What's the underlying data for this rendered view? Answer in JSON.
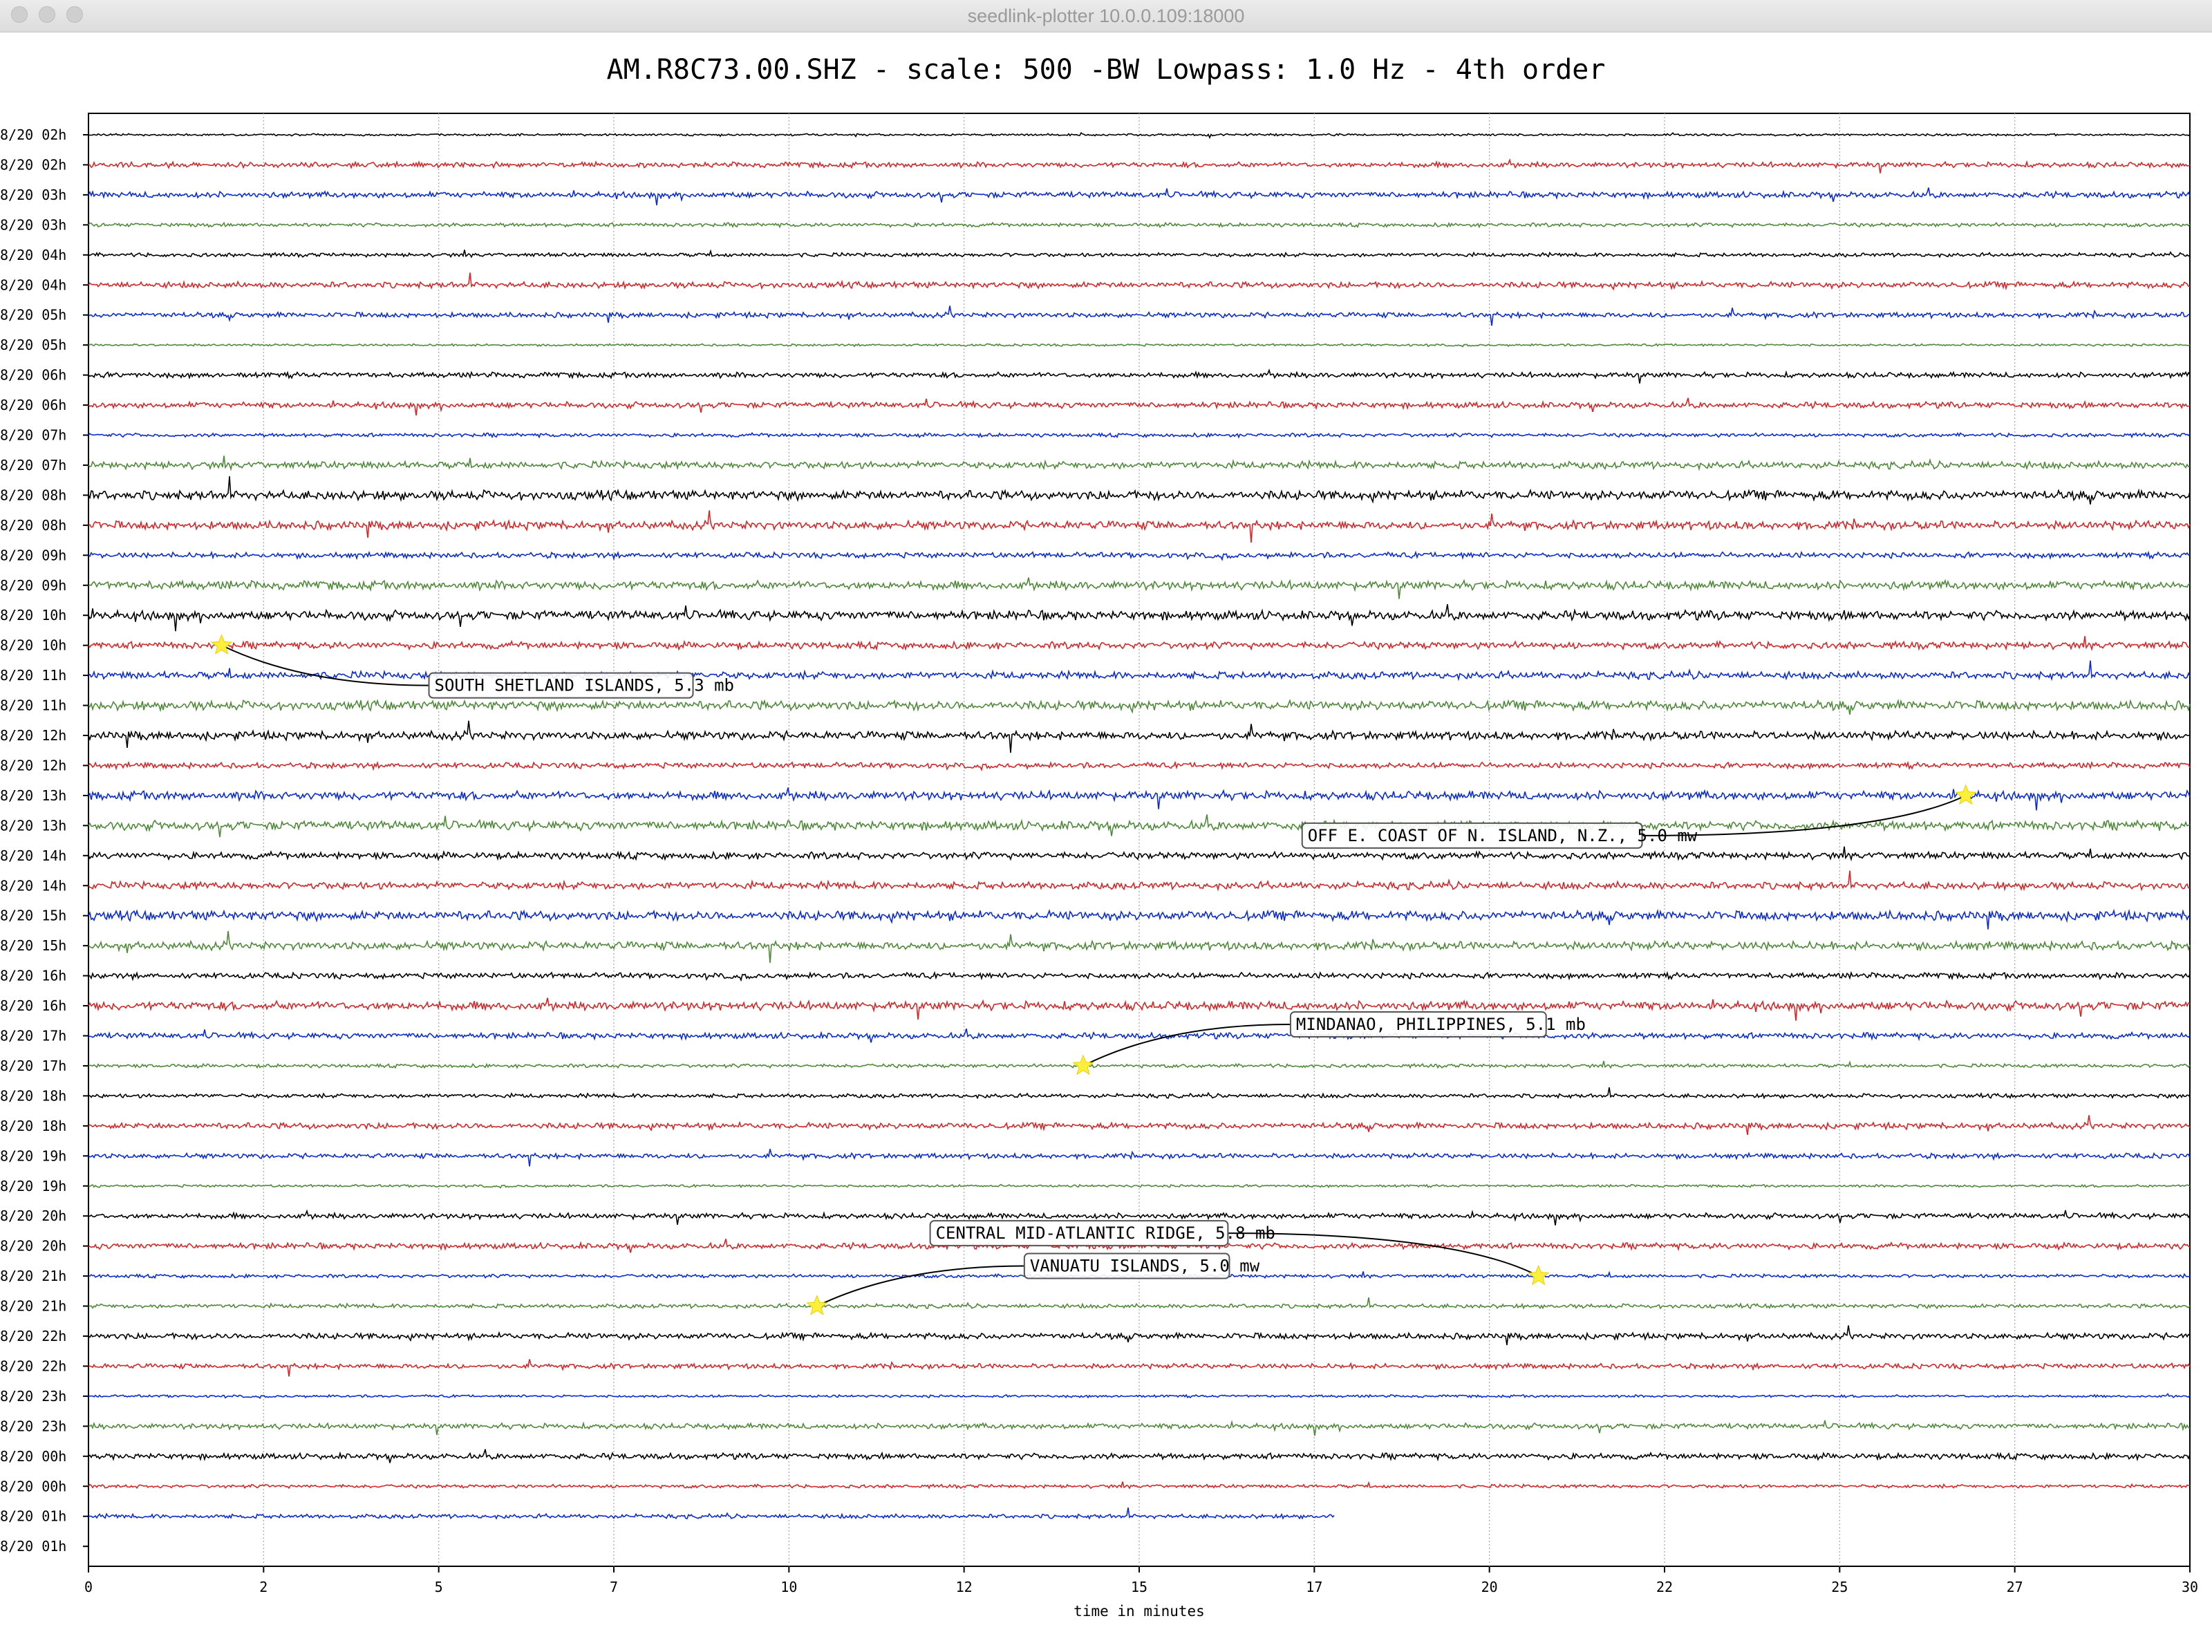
{
  "window": {
    "title": "seedlink-plotter 10.0.0.109:18000"
  },
  "chart_data": {
    "type": "line",
    "title": "AM.R8C73.00.SHZ - scale: 500 -BW Lowpass: 1.0 Hz - 4th order",
    "xlabel": "time in minutes",
    "ylabel": "",
    "xlim": [
      0,
      30
    ],
    "x_ticks": [
      {
        "value": 0,
        "label": "0"
      },
      {
        "value": 2.5,
        "label": "2"
      },
      {
        "value": 5,
        "label": "5"
      },
      {
        "value": 7.5,
        "label": "7"
      },
      {
        "value": 10,
        "label": "10"
      },
      {
        "value": 12.5,
        "label": "12"
      },
      {
        "value": 15,
        "label": "15"
      },
      {
        "value": 17.5,
        "label": "17"
      },
      {
        "value": 20,
        "label": "20"
      },
      {
        "value": 22.5,
        "label": "22"
      },
      {
        "value": 25,
        "label": "25"
      },
      {
        "value": 27.5,
        "label": "27"
      },
      {
        "value": 30,
        "label": "30"
      }
    ],
    "grid": true,
    "trace_colors": [
      "#000000",
      "#d62728",
      "#0a2bd6",
      "#4f8a3a"
    ],
    "rows": [
      "8/20 02h",
      "8/20 02h",
      "8/20 03h",
      "8/20 03h",
      "8/20 04h",
      "8/20 04h",
      "8/20 05h",
      "8/20 05h",
      "8/20 06h",
      "8/20 06h",
      "8/20 07h",
      "8/20 07h",
      "8/20 08h",
      "8/20 08h",
      "8/20 09h",
      "8/20 09h",
      "8/20 10h",
      "8/20 10h",
      "8/20 11h",
      "8/20 11h",
      "8/20 12h",
      "8/20 12h",
      "8/20 13h",
      "8/20 13h",
      "8/20 14h",
      "8/20 14h",
      "8/20 15h",
      "8/20 15h",
      "8/20 16h",
      "8/20 16h",
      "8/20 17h",
      "8/20 17h",
      "8/20 18h",
      "8/20 18h",
      "8/20 19h",
      "8/20 19h",
      "8/20 20h",
      "8/20 20h",
      "8/20 21h",
      "8/20 21h",
      "8/20 22h",
      "8/20 22h",
      "8/20 23h",
      "8/20 23h",
      "8/20 00h",
      "8/20 00h",
      "8/20 01h",
      "8/20 01h"
    ],
    "last_trace_end_minutes": 17.8,
    "events": [
      {
        "label": "SOUTH SHETLAND ISLANDS, 5.3 mb",
        "row": 17,
        "minute": 1.9
      },
      {
        "label": "OFF E. COAST OF N. ISLAND, N.Z., 5.0 mw",
        "row": 22,
        "minute": 26.8
      },
      {
        "label": "MINDANAO, PHILIPPINES, 5.1 mb",
        "row": 31,
        "minute": 14.2
      },
      {
        "label": "CENTRAL MID-ATLANTIC RIDGE, 5.8 mb",
        "row": 38,
        "minute": 20.7
      },
      {
        "label": "VANUATU ISLANDS, 5.0 mw",
        "row": 39,
        "minute": 10.4
      }
    ]
  }
}
